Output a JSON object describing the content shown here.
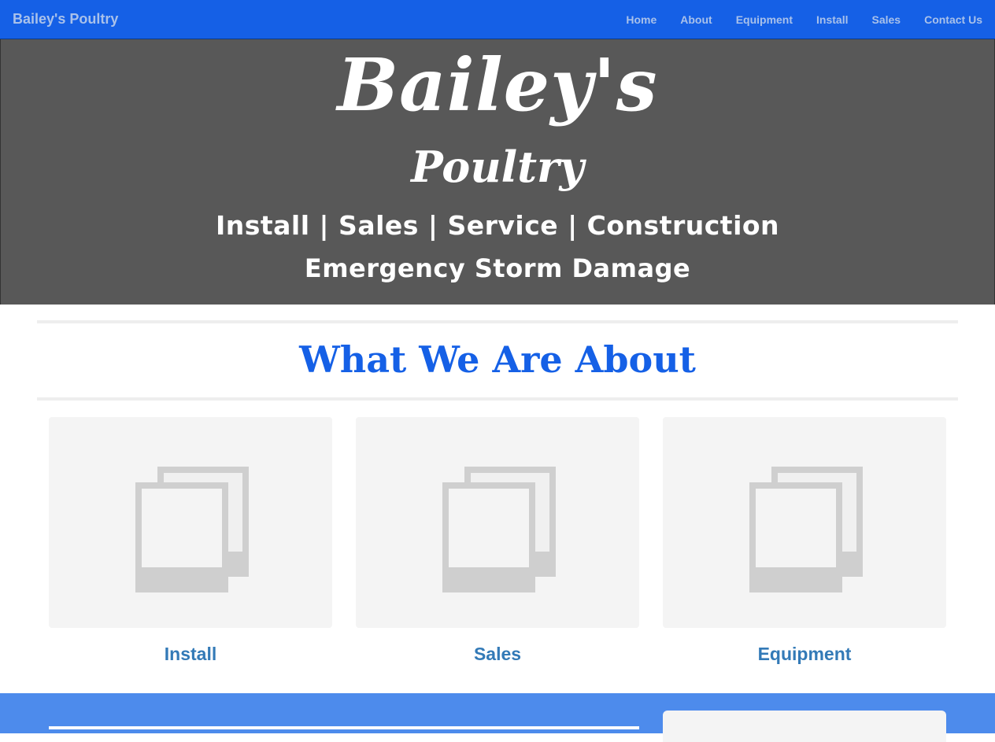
{
  "navbar": {
    "brand": "Bailey's Poultry",
    "links": [
      "Home",
      "About",
      "Equipment",
      "Install",
      "Sales",
      "Contact Us"
    ]
  },
  "hero": {
    "title": "Bailey's",
    "subtitle": "Poultry",
    "tagline1": "Install | Sales | Service | Construction",
    "tagline2": "Emergency Storm Damage"
  },
  "about": {
    "heading": "What We Are About",
    "cards": [
      {
        "label": "Install",
        "image_icon": "image-placeholder-icon"
      },
      {
        "label": "Sales",
        "image_icon": "image-placeholder-icon"
      },
      {
        "label": "Equipment",
        "image_icon": "image-placeholder-icon"
      }
    ]
  },
  "colors": {
    "nav_bg": "#1560e6",
    "hero_bg": "#585858",
    "heading": "#1560e6",
    "card_label": "#337ab7",
    "footer_bg": "#4d8bec"
  }
}
